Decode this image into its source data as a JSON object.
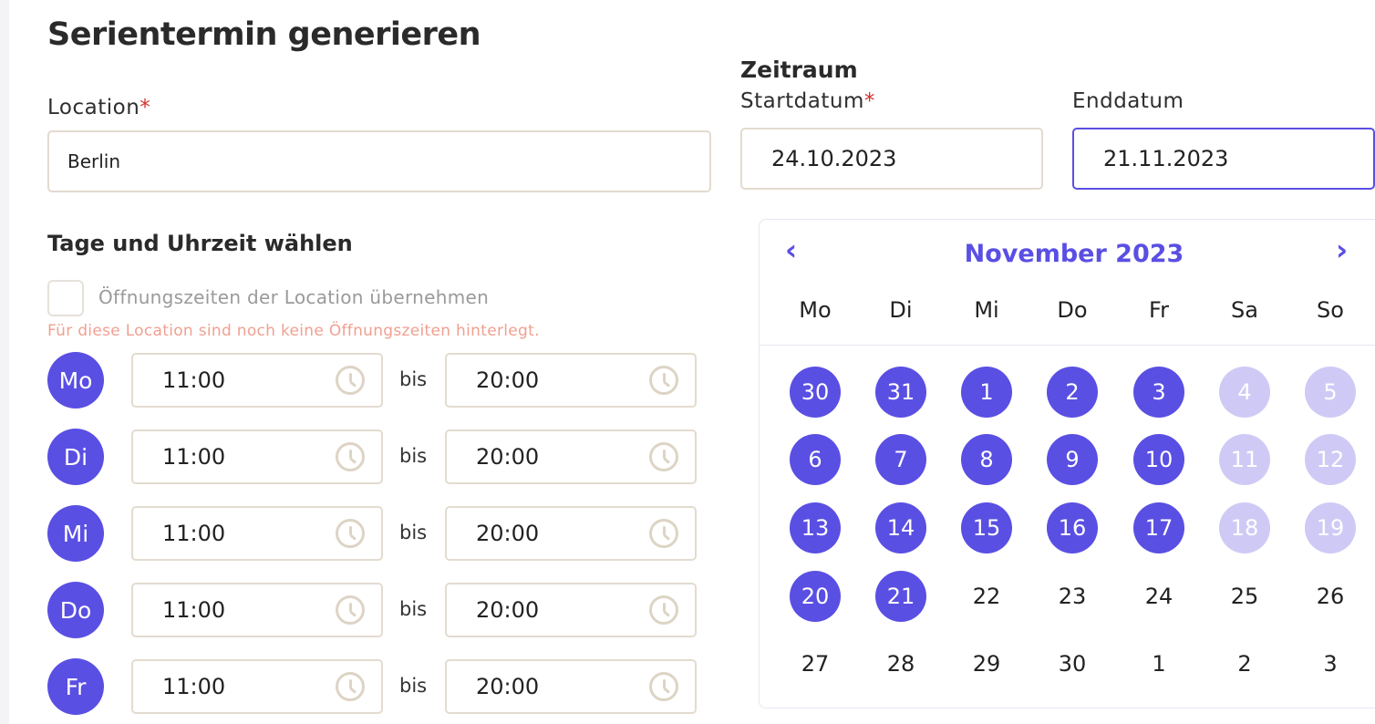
{
  "title": "Serientermin generieren",
  "location": {
    "label": "Location",
    "required_mark": "*",
    "value": "Berlin"
  },
  "zeitraum": {
    "title": "Zeitraum",
    "start_label": "Startdatum",
    "start_required_mark": "*",
    "start_value": "24.10.2023",
    "end_label": "Enddatum",
    "end_value": "21.11.2023"
  },
  "times_section": {
    "title": "Tage und Uhrzeit wählen",
    "checkbox_label": "Öffnungszeiten der Location übernehmen",
    "checkbox_checked": false,
    "warning": "Für diese Location sind noch keine Öffnungszeiten hinterlegt.",
    "bis_label": "bis",
    "rows": [
      {
        "day": "Mo",
        "from": "11:00",
        "to": "20:00"
      },
      {
        "day": "Di",
        "from": "11:00",
        "to": "20:00"
      },
      {
        "day": "Mi",
        "from": "11:00",
        "to": "20:00"
      },
      {
        "day": "Do",
        "from": "11:00",
        "to": "20:00"
      },
      {
        "day": "Fr",
        "from": "11:00",
        "to": "20:00"
      }
    ]
  },
  "calendar": {
    "month_title": "November 2023",
    "prev_icon": "chevron-left-icon",
    "next_icon": "chevron-right-icon",
    "weekdays": [
      "Mo",
      "Di",
      "Mi",
      "Do",
      "Fr",
      "Sa",
      "So"
    ],
    "weeks": [
      [
        {
          "d": "30",
          "s": "sel"
        },
        {
          "d": "31",
          "s": "sel"
        },
        {
          "d": "1",
          "s": "sel"
        },
        {
          "d": "2",
          "s": "sel"
        },
        {
          "d": "3",
          "s": "sel"
        },
        {
          "d": "4",
          "s": "dim"
        },
        {
          "d": "5",
          "s": "dim"
        }
      ],
      [
        {
          "d": "6",
          "s": "sel"
        },
        {
          "d": "7",
          "s": "sel"
        },
        {
          "d": "8",
          "s": "sel"
        },
        {
          "d": "9",
          "s": "sel"
        },
        {
          "d": "10",
          "s": "sel"
        },
        {
          "d": "11",
          "s": "dim"
        },
        {
          "d": "12",
          "s": "dim"
        }
      ],
      [
        {
          "d": "13",
          "s": "sel"
        },
        {
          "d": "14",
          "s": "sel"
        },
        {
          "d": "15",
          "s": "sel"
        },
        {
          "d": "16",
          "s": "sel"
        },
        {
          "d": "17",
          "s": "sel"
        },
        {
          "d": "18",
          "s": "dim"
        },
        {
          "d": "19",
          "s": "dim"
        }
      ],
      [
        {
          "d": "20",
          "s": "sel"
        },
        {
          "d": "21",
          "s": "sel"
        },
        {
          "d": "22",
          "s": ""
        },
        {
          "d": "23",
          "s": ""
        },
        {
          "d": "24",
          "s": ""
        },
        {
          "d": "25",
          "s": ""
        },
        {
          "d": "26",
          "s": ""
        }
      ],
      [
        {
          "d": "27",
          "s": ""
        },
        {
          "d": "28",
          "s": ""
        },
        {
          "d": "29",
          "s": ""
        },
        {
          "d": "30",
          "s": ""
        },
        {
          "d": "1",
          "s": ""
        },
        {
          "d": "2",
          "s": ""
        },
        {
          "d": "3",
          "s": ""
        }
      ]
    ]
  },
  "colors": {
    "accent": "#5a4fe3",
    "accent_light": "#cfcaf5",
    "border": "#e3dbcf",
    "required": "#d3312f",
    "warning": "#f0a091"
  }
}
